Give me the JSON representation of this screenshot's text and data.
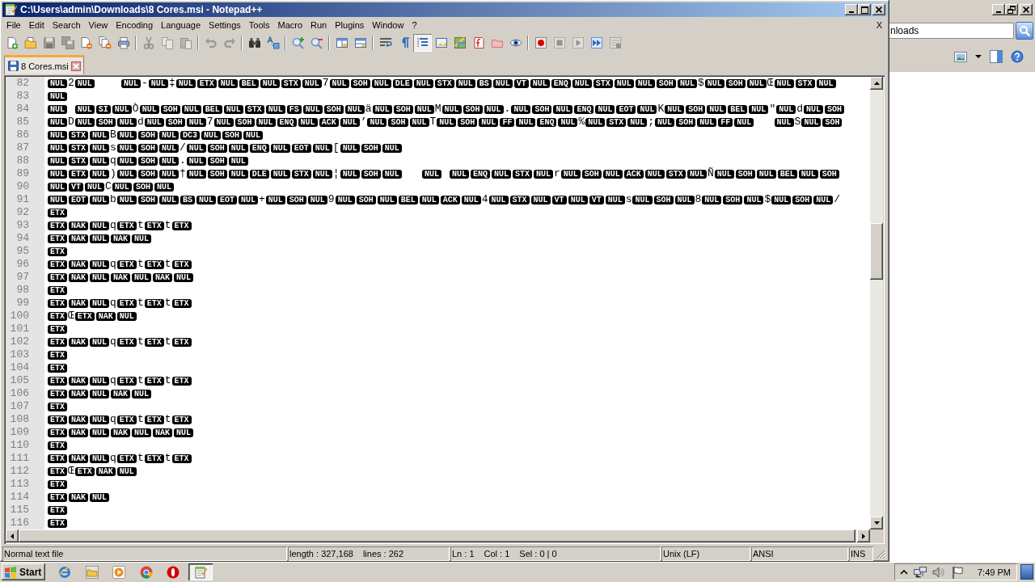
{
  "window": {
    "title": "C:\\Users\\admin\\Downloads\\8 Cores.msi - Notepad++"
  },
  "menu": {
    "items": [
      "File",
      "Edit",
      "Search",
      "View",
      "Encoding",
      "Language",
      "Settings",
      "Tools",
      "Macro",
      "Run",
      "Plugins",
      "Window",
      "?"
    ],
    "close": "X"
  },
  "toolbar": [
    {
      "pressed": false,
      "disabled": false
    },
    {
      "pressed": false,
      "disabled": false
    },
    {
      "pressed": false,
      "disabled": true
    },
    {
      "pressed": false,
      "disabled": true
    },
    {
      "pressed": false,
      "disabled": false
    },
    {
      "pressed": false,
      "disabled": false
    },
    {
      "pressed": false,
      "disabled": false
    },
    {
      "pressed": false,
      "disabled": true
    },
    {
      "pressed": false,
      "disabled": true
    },
    {
      "pressed": false,
      "disabled": true
    },
    {
      "pressed": false,
      "disabled": true
    },
    {
      "pressed": false,
      "disabled": true
    },
    {
      "pressed": false,
      "disabled": false
    },
    {
      "pressed": false,
      "disabled": false
    },
    {
      "pressed": false,
      "disabled": false
    },
    {
      "pressed": false,
      "disabled": false
    },
    {
      "pressed": false,
      "disabled": false
    },
    {
      "pressed": false,
      "disabled": false
    },
    {
      "pressed": false,
      "disabled": false
    },
    {
      "pressed": false,
      "disabled": false
    },
    {
      "pressed": true,
      "disabled": false
    },
    {
      "pressed": false,
      "disabled": false
    },
    {
      "pressed": false,
      "disabled": false
    },
    {
      "pressed": false,
      "disabled": false
    },
    {
      "pressed": false,
      "disabled": false
    },
    {
      "pressed": false,
      "disabled": false
    },
    {
      "pressed": false,
      "disabled": false
    },
    {
      "pressed": false,
      "disabled": true
    },
    {
      "pressed": false,
      "disabled": true
    },
    {
      "pressed": false,
      "disabled": false
    },
    {
      "pressed": false,
      "disabled": true
    }
  ],
  "tabs": [
    {
      "label": "8 Cores.msi",
      "selected": true
    }
  ],
  "editor": {
    "lines": [
      {
        "number": "82",
        "tokens": [
          {
            "kind": "ctrl",
            "text": "NUL"
          },
          {
            "kind": "char",
            "text": "2"
          },
          {
            "kind": "ctrl",
            "text": "NUL"
          },
          {
            "kind": "space"
          },
          {
            "kind": "space"
          },
          {
            "kind": "space"
          },
          {
            "kind": "space"
          },
          {
            "kind": "ctrl",
            "text": "NUL"
          },
          {
            "kind": "char",
            "text": "-"
          },
          {
            "kind": "ctrl",
            "text": "NUL"
          },
          {
            "kind": "char",
            "text": "‡"
          },
          {
            "kind": "ctrl",
            "text": "NUL"
          },
          {
            "kind": "ctrl",
            "text": "ETX"
          },
          {
            "kind": "ctrl",
            "text": "NUL"
          },
          {
            "kind": "ctrl",
            "text": "BEL"
          },
          {
            "kind": "ctrl",
            "text": "NUL"
          },
          {
            "kind": "ctrl",
            "text": "STX"
          },
          {
            "kind": "ctrl",
            "text": "NUL"
          },
          {
            "kind": "char",
            "text": "7"
          },
          {
            "kind": "ctrl",
            "text": "NUL"
          },
          {
            "kind": "ctrl",
            "text": "SOH"
          },
          {
            "kind": "ctrl",
            "text": "NUL"
          },
          {
            "kind": "ctrl",
            "text": "DLE"
          },
          {
            "kind": "ctrl",
            "text": "NUL"
          },
          {
            "kind": "ctrl",
            "text": "STX"
          },
          {
            "kind": "ctrl",
            "text": "NUL"
          },
          {
            "kind": "ctrl",
            "text": "BS"
          },
          {
            "kind": "ctrl",
            "text": "NUL"
          },
          {
            "kind": "ctrl",
            "text": "VT"
          },
          {
            "kind": "ctrl",
            "text": "NUL"
          },
          {
            "kind": "ctrl",
            "text": "ENQ"
          },
          {
            "kind": "ctrl",
            "text": "NUL"
          },
          {
            "kind": "ctrl",
            "text": "STX"
          },
          {
            "kind": "ctrl",
            "text": "NUL"
          },
          {
            "kind": "ctrl",
            "text": "NUL"
          },
          {
            "kind": "ctrl",
            "text": "SOH"
          },
          {
            "kind": "ctrl",
            "text": "NUL"
          },
          {
            "kind": "char",
            "text": "$"
          },
          {
            "kind": "ctrl",
            "text": "NUL"
          },
          {
            "kind": "ctrl",
            "text": "SOH"
          },
          {
            "kind": "ctrl",
            "text": "NUL"
          },
          {
            "kind": "char",
            "text": "Œ"
          },
          {
            "kind": "ctrl",
            "text": "NUL"
          },
          {
            "kind": "ctrl",
            "text": "STX"
          },
          {
            "kind": "ctrl",
            "text": "NUL"
          }
        ]
      },
      {
        "number": "83",
        "tokens": [
          {
            "kind": "ctrl",
            "text": "NUL"
          }
        ]
      },
      {
        "number": "84",
        "tokens": [
          {
            "kind": "ctrl",
            "text": "NUL"
          },
          {
            "kind": "space"
          },
          {
            "kind": "ctrl",
            "text": "NUL"
          },
          {
            "kind": "ctrl",
            "text": "SI"
          },
          {
            "kind": "ctrl",
            "text": "NUL"
          },
          {
            "kind": "char",
            "text": "Ò"
          },
          {
            "kind": "ctrl",
            "text": "NUL"
          },
          {
            "kind": "ctrl",
            "text": "SOH"
          },
          {
            "kind": "ctrl",
            "text": "NUL"
          },
          {
            "kind": "ctrl",
            "text": "BEL"
          },
          {
            "kind": "ctrl",
            "text": "NUL"
          },
          {
            "kind": "ctrl",
            "text": "STX"
          },
          {
            "kind": "ctrl",
            "text": "NUL"
          },
          {
            "kind": "ctrl",
            "text": "FS"
          },
          {
            "kind": "ctrl",
            "text": "NUL"
          },
          {
            "kind": "ctrl",
            "text": "SOH"
          },
          {
            "kind": "ctrl",
            "text": "NUL"
          },
          {
            "kind": "char",
            "text": "ä"
          },
          {
            "kind": "ctrl",
            "text": "NUL"
          },
          {
            "kind": "ctrl",
            "text": "SOH"
          },
          {
            "kind": "ctrl",
            "text": "NUL"
          },
          {
            "kind": "char",
            "text": "M"
          },
          {
            "kind": "ctrl",
            "text": "NUL"
          },
          {
            "kind": "ctrl",
            "text": "SOH"
          },
          {
            "kind": "ctrl",
            "text": "NUL"
          },
          {
            "kind": "char",
            "text": "."
          },
          {
            "kind": "ctrl",
            "text": "NUL"
          },
          {
            "kind": "ctrl",
            "text": "SOH"
          },
          {
            "kind": "ctrl",
            "text": "NUL"
          },
          {
            "kind": "ctrl",
            "text": "ENQ"
          },
          {
            "kind": "ctrl",
            "text": "NUL"
          },
          {
            "kind": "ctrl",
            "text": "EOT"
          },
          {
            "kind": "ctrl",
            "text": "NUL"
          },
          {
            "kind": "char",
            "text": "K"
          },
          {
            "kind": "ctrl",
            "text": "NUL"
          },
          {
            "kind": "ctrl",
            "text": "SOH"
          },
          {
            "kind": "ctrl",
            "text": "NUL"
          },
          {
            "kind": "ctrl",
            "text": "BEL"
          },
          {
            "kind": "ctrl",
            "text": "NUL"
          },
          {
            "kind": "char",
            "text": "\""
          },
          {
            "kind": "ctrl",
            "text": "NUL"
          },
          {
            "kind": "char",
            "text": "d"
          },
          {
            "kind": "ctrl",
            "text": "NUL"
          },
          {
            "kind": "ctrl",
            "text": "SOH"
          }
        ]
      },
      {
        "number": "85",
        "tokens": [
          {
            "kind": "ctrl",
            "text": "NUL"
          },
          {
            "kind": "char",
            "text": "D"
          },
          {
            "kind": "ctrl",
            "text": "NUL"
          },
          {
            "kind": "ctrl",
            "text": "SOH"
          },
          {
            "kind": "ctrl",
            "text": "NUL"
          },
          {
            "kind": "char",
            "text": "d"
          },
          {
            "kind": "ctrl",
            "text": "NUL"
          },
          {
            "kind": "ctrl",
            "text": "SOH"
          },
          {
            "kind": "ctrl",
            "text": "NUL"
          },
          {
            "kind": "char",
            "text": "7"
          },
          {
            "kind": "ctrl",
            "text": "NUL"
          },
          {
            "kind": "ctrl",
            "text": "SOH"
          },
          {
            "kind": "ctrl",
            "text": "NUL"
          },
          {
            "kind": "ctrl",
            "text": "ENQ"
          },
          {
            "kind": "ctrl",
            "text": "NUL"
          },
          {
            "kind": "ctrl",
            "text": "ACK"
          },
          {
            "kind": "ctrl",
            "text": "NUL"
          },
          {
            "kind": "char",
            "text": "’"
          },
          {
            "kind": "ctrl",
            "text": "NUL"
          },
          {
            "kind": "ctrl",
            "text": "SOH"
          },
          {
            "kind": "ctrl",
            "text": "NUL"
          },
          {
            "kind": "char",
            "text": "T"
          },
          {
            "kind": "ctrl",
            "text": "NUL"
          },
          {
            "kind": "ctrl",
            "text": "SOH"
          },
          {
            "kind": "ctrl",
            "text": "NUL"
          },
          {
            "kind": "ctrl",
            "text": "FF"
          },
          {
            "kind": "ctrl",
            "text": "NUL"
          },
          {
            "kind": "ctrl",
            "text": "ENQ"
          },
          {
            "kind": "ctrl",
            "text": "NUL"
          },
          {
            "kind": "char",
            "text": "%"
          },
          {
            "kind": "ctrl",
            "text": "NUL"
          },
          {
            "kind": "ctrl",
            "text": "STX"
          },
          {
            "kind": "ctrl",
            "text": "NUL"
          },
          {
            "kind": "char",
            "text": ";"
          },
          {
            "kind": "ctrl",
            "text": "NUL"
          },
          {
            "kind": "ctrl",
            "text": "SOH"
          },
          {
            "kind": "ctrl",
            "text": "NUL"
          },
          {
            "kind": "ctrl",
            "text": "FF"
          },
          {
            "kind": "ctrl",
            "text": "NUL"
          },
          {
            "kind": "space"
          },
          {
            "kind": "space"
          },
          {
            "kind": "space"
          },
          {
            "kind": "ctrl",
            "text": "NUL"
          },
          {
            "kind": "char",
            "text": "S"
          },
          {
            "kind": "ctrl",
            "text": "NUL"
          },
          {
            "kind": "ctrl",
            "text": "SOH"
          }
        ]
      },
      {
        "number": "86",
        "tokens": [
          {
            "kind": "ctrl",
            "text": "NUL"
          },
          {
            "kind": "ctrl",
            "text": "STX"
          },
          {
            "kind": "ctrl",
            "text": "NUL"
          },
          {
            "kind": "char",
            "text": "B"
          },
          {
            "kind": "ctrl",
            "text": "NUL"
          },
          {
            "kind": "ctrl",
            "text": "SOH"
          },
          {
            "kind": "ctrl",
            "text": "NUL"
          },
          {
            "kind": "ctrl",
            "text": "DC3"
          },
          {
            "kind": "ctrl",
            "text": "NUL"
          },
          {
            "kind": "ctrl",
            "text": "SOH"
          },
          {
            "kind": "ctrl",
            "text": "NUL"
          }
        ]
      },
      {
        "number": "87",
        "tokens": [
          {
            "kind": "ctrl",
            "text": "NUL"
          },
          {
            "kind": "ctrl",
            "text": "STX"
          },
          {
            "kind": "ctrl",
            "text": "NUL"
          },
          {
            "kind": "char",
            "text": "s"
          },
          {
            "kind": "ctrl",
            "text": "NUL"
          },
          {
            "kind": "ctrl",
            "text": "SOH"
          },
          {
            "kind": "ctrl",
            "text": "NUL"
          },
          {
            "kind": "char",
            "text": "/"
          },
          {
            "kind": "ctrl",
            "text": "NUL"
          },
          {
            "kind": "ctrl",
            "text": "SOH"
          },
          {
            "kind": "ctrl",
            "text": "NUL"
          },
          {
            "kind": "ctrl",
            "text": "ENQ"
          },
          {
            "kind": "ctrl",
            "text": "NUL"
          },
          {
            "kind": "ctrl",
            "text": "EOT"
          },
          {
            "kind": "ctrl",
            "text": "NUL"
          },
          {
            "kind": "char",
            "text": "["
          },
          {
            "kind": "ctrl",
            "text": "NUL"
          },
          {
            "kind": "ctrl",
            "text": "SOH"
          },
          {
            "kind": "ctrl",
            "text": "NUL"
          }
        ]
      },
      {
        "number": "88",
        "tokens": [
          {
            "kind": "ctrl",
            "text": "NUL"
          },
          {
            "kind": "ctrl",
            "text": "STX"
          },
          {
            "kind": "ctrl",
            "text": "NUL"
          },
          {
            "kind": "char",
            "text": "q"
          },
          {
            "kind": "ctrl",
            "text": "NUL"
          },
          {
            "kind": "ctrl",
            "text": "SOH"
          },
          {
            "kind": "ctrl",
            "text": "NUL"
          },
          {
            "kind": "char",
            "text": "."
          },
          {
            "kind": "ctrl",
            "text": "NUL"
          },
          {
            "kind": "ctrl",
            "text": "SOH"
          },
          {
            "kind": "ctrl",
            "text": "NUL"
          }
        ]
      },
      {
        "number": "89",
        "tokens": [
          {
            "kind": "ctrl",
            "text": "NUL"
          },
          {
            "kind": "ctrl",
            "text": "ETX"
          },
          {
            "kind": "ctrl",
            "text": "NUL"
          },
          {
            "kind": "char",
            "text": ")"
          },
          {
            "kind": "ctrl",
            "text": "NUL"
          },
          {
            "kind": "ctrl",
            "text": "SOH"
          },
          {
            "kind": "ctrl",
            "text": "NUL"
          },
          {
            "kind": "char",
            "text": "†"
          },
          {
            "kind": "ctrl",
            "text": "NUL"
          },
          {
            "kind": "ctrl",
            "text": "SOH"
          },
          {
            "kind": "ctrl",
            "text": "NUL"
          },
          {
            "kind": "ctrl",
            "text": "DLE"
          },
          {
            "kind": "ctrl",
            "text": "NUL"
          },
          {
            "kind": "ctrl",
            "text": "STX"
          },
          {
            "kind": "ctrl",
            "text": "NUL"
          },
          {
            "kind": "char",
            "text": "¦"
          },
          {
            "kind": "ctrl",
            "text": "NUL"
          },
          {
            "kind": "ctrl",
            "text": "SOH"
          },
          {
            "kind": "ctrl",
            "text": "NUL"
          },
          {
            "kind": "space"
          },
          {
            "kind": "space"
          },
          {
            "kind": "space"
          },
          {
            "kind": "ctrl",
            "text": "NUL"
          },
          {
            "kind": "space"
          },
          {
            "kind": "ctrl",
            "text": "NUL"
          },
          {
            "kind": "ctrl",
            "text": "ENQ"
          },
          {
            "kind": "ctrl",
            "text": "NUL"
          },
          {
            "kind": "ctrl",
            "text": "STX"
          },
          {
            "kind": "ctrl",
            "text": "NUL"
          },
          {
            "kind": "char",
            "text": "r"
          },
          {
            "kind": "ctrl",
            "text": "NUL"
          },
          {
            "kind": "ctrl",
            "text": "SOH"
          },
          {
            "kind": "ctrl",
            "text": "NUL"
          },
          {
            "kind": "ctrl",
            "text": "ACK"
          },
          {
            "kind": "ctrl",
            "text": "NUL"
          },
          {
            "kind": "ctrl",
            "text": "STX"
          },
          {
            "kind": "ctrl",
            "text": "NUL"
          },
          {
            "kind": "char",
            "text": "Ñ"
          },
          {
            "kind": "ctrl",
            "text": "NUL"
          },
          {
            "kind": "ctrl",
            "text": "SOH"
          },
          {
            "kind": "ctrl",
            "text": "NUL"
          },
          {
            "kind": "ctrl",
            "text": "BEL"
          },
          {
            "kind": "ctrl",
            "text": "NUL"
          },
          {
            "kind": "ctrl",
            "text": "SOH"
          }
        ]
      },
      {
        "number": "90",
        "tokens": [
          {
            "kind": "ctrl",
            "text": "NUL"
          },
          {
            "kind": "ctrl",
            "text": "VT"
          },
          {
            "kind": "ctrl",
            "text": "NUL"
          },
          {
            "kind": "char",
            "text": "C"
          },
          {
            "kind": "ctrl",
            "text": "NUL"
          },
          {
            "kind": "ctrl",
            "text": "SOH"
          },
          {
            "kind": "ctrl",
            "text": "NUL"
          }
        ]
      },
      {
        "number": "91",
        "tokens": [
          {
            "kind": "ctrl",
            "text": "NUL"
          },
          {
            "kind": "ctrl",
            "text": "EOT"
          },
          {
            "kind": "ctrl",
            "text": "NUL"
          },
          {
            "kind": "char",
            "text": "b"
          },
          {
            "kind": "ctrl",
            "text": "NUL"
          },
          {
            "kind": "ctrl",
            "text": "SOH"
          },
          {
            "kind": "ctrl",
            "text": "NUL"
          },
          {
            "kind": "ctrl",
            "text": "BS"
          },
          {
            "kind": "ctrl",
            "text": "NUL"
          },
          {
            "kind": "ctrl",
            "text": "EOT"
          },
          {
            "kind": "ctrl",
            "text": "NUL"
          },
          {
            "kind": "char",
            "text": "+"
          },
          {
            "kind": "ctrl",
            "text": "NUL"
          },
          {
            "kind": "ctrl",
            "text": "SOH"
          },
          {
            "kind": "ctrl",
            "text": "NUL"
          },
          {
            "kind": "char",
            "text": "9"
          },
          {
            "kind": "ctrl",
            "text": "NUL"
          },
          {
            "kind": "ctrl",
            "text": "SOH"
          },
          {
            "kind": "ctrl",
            "text": "NUL"
          },
          {
            "kind": "ctrl",
            "text": "BEL"
          },
          {
            "kind": "ctrl",
            "text": "NUL"
          },
          {
            "kind": "ctrl",
            "text": "ACK"
          },
          {
            "kind": "ctrl",
            "text": "NUL"
          },
          {
            "kind": "char",
            "text": "4"
          },
          {
            "kind": "ctrl",
            "text": "NUL"
          },
          {
            "kind": "ctrl",
            "text": "STX"
          },
          {
            "kind": "ctrl",
            "text": "NUL"
          },
          {
            "kind": "ctrl",
            "text": "VT"
          },
          {
            "kind": "ctrl",
            "text": "NUL"
          },
          {
            "kind": "ctrl",
            "text": "VT"
          },
          {
            "kind": "ctrl",
            "text": "NUL"
          },
          {
            "kind": "char",
            "text": "s"
          },
          {
            "kind": "ctrl",
            "text": "NUL"
          },
          {
            "kind": "ctrl",
            "text": "SOH"
          },
          {
            "kind": "ctrl",
            "text": "NUL"
          },
          {
            "kind": "char",
            "text": "8"
          },
          {
            "kind": "ctrl",
            "text": "NUL"
          },
          {
            "kind": "ctrl",
            "text": "SOH"
          },
          {
            "kind": "ctrl",
            "text": "NUL"
          },
          {
            "kind": "char",
            "text": "$"
          },
          {
            "kind": "ctrl",
            "text": "NUL"
          },
          {
            "kind": "ctrl",
            "text": "SOH"
          },
          {
            "kind": "ctrl",
            "text": "NUL"
          },
          {
            "kind": "char",
            "text": "/"
          }
        ]
      },
      {
        "number": "92",
        "tokens": [
          {
            "kind": "ctrl",
            "text": "ETX"
          }
        ]
      },
      {
        "number": "93",
        "tokens": [
          {
            "kind": "ctrl",
            "text": "ETX"
          },
          {
            "kind": "ctrl",
            "text": "NAK"
          },
          {
            "kind": "ctrl",
            "text": "NUL"
          },
          {
            "kind": "char",
            "text": "q"
          },
          {
            "kind": "ctrl",
            "text": "ETX"
          },
          {
            "kind": "char",
            "text": "t"
          },
          {
            "kind": "ctrl",
            "text": "ETX"
          },
          {
            "kind": "char",
            "text": "t"
          },
          {
            "kind": "ctrl",
            "text": "ETX"
          }
        ]
      },
      {
        "number": "94",
        "tokens": [
          {
            "kind": "ctrl",
            "text": "ETX"
          },
          {
            "kind": "ctrl",
            "text": "NAK"
          },
          {
            "kind": "ctrl",
            "text": "NUL"
          },
          {
            "kind": "ctrl",
            "text": "NAK"
          },
          {
            "kind": "ctrl",
            "text": "NUL"
          }
        ]
      },
      {
        "number": "95",
        "tokens": [
          {
            "kind": "ctrl",
            "text": "ETX"
          }
        ]
      },
      {
        "number": "96",
        "tokens": [
          {
            "kind": "ctrl",
            "text": "ETX"
          },
          {
            "kind": "ctrl",
            "text": "NAK"
          },
          {
            "kind": "ctrl",
            "text": "NUL"
          },
          {
            "kind": "char",
            "text": "q"
          },
          {
            "kind": "ctrl",
            "text": "ETX"
          },
          {
            "kind": "char",
            "text": "t"
          },
          {
            "kind": "ctrl",
            "text": "ETX"
          },
          {
            "kind": "char",
            "text": "t"
          },
          {
            "kind": "ctrl",
            "text": "ETX"
          }
        ]
      },
      {
        "number": "97",
        "tokens": [
          {
            "kind": "ctrl",
            "text": "ETX"
          },
          {
            "kind": "ctrl",
            "text": "NAK"
          },
          {
            "kind": "ctrl",
            "text": "NUL"
          },
          {
            "kind": "ctrl",
            "text": "NAK"
          },
          {
            "kind": "ctrl",
            "text": "NUL"
          },
          {
            "kind": "ctrl",
            "text": "NAK"
          },
          {
            "kind": "ctrl",
            "text": "NUL"
          }
        ]
      },
      {
        "number": "98",
        "tokens": [
          {
            "kind": "ctrl",
            "text": "ETX"
          }
        ]
      },
      {
        "number": "99",
        "tokens": [
          {
            "kind": "ctrl",
            "text": "ETX"
          },
          {
            "kind": "ctrl",
            "text": "NAK"
          },
          {
            "kind": "ctrl",
            "text": "NUL"
          },
          {
            "kind": "char",
            "text": "q"
          },
          {
            "kind": "ctrl",
            "text": "ETX"
          },
          {
            "kind": "char",
            "text": "t"
          },
          {
            "kind": "ctrl",
            "text": "ETX"
          },
          {
            "kind": "char",
            "text": "t"
          },
          {
            "kind": "ctrl",
            "text": "ETX"
          }
        ]
      },
      {
        "number": "100",
        "tokens": [
          {
            "kind": "ctrl",
            "text": "ETX"
          },
          {
            "kind": "char",
            "text": "Œ"
          },
          {
            "kind": "ctrl",
            "text": "ETX"
          },
          {
            "kind": "ctrl",
            "text": "NAK"
          },
          {
            "kind": "ctrl",
            "text": "NUL"
          }
        ]
      },
      {
        "number": "101",
        "tokens": [
          {
            "kind": "ctrl",
            "text": "ETX"
          }
        ]
      },
      {
        "number": "102",
        "tokens": [
          {
            "kind": "ctrl",
            "text": "ETX"
          },
          {
            "kind": "ctrl",
            "text": "NAK"
          },
          {
            "kind": "ctrl",
            "text": "NUL"
          },
          {
            "kind": "char",
            "text": "q"
          },
          {
            "kind": "ctrl",
            "text": "ETX"
          },
          {
            "kind": "char",
            "text": "t"
          },
          {
            "kind": "ctrl",
            "text": "ETX"
          },
          {
            "kind": "char",
            "text": "t"
          },
          {
            "kind": "ctrl",
            "text": "ETX"
          }
        ]
      },
      {
        "number": "103",
        "tokens": [
          {
            "kind": "ctrl",
            "text": "ETX"
          }
        ]
      },
      {
        "number": "104",
        "tokens": [
          {
            "kind": "ctrl",
            "text": "ETX"
          }
        ]
      },
      {
        "number": "105",
        "tokens": [
          {
            "kind": "ctrl",
            "text": "ETX"
          },
          {
            "kind": "ctrl",
            "text": "NAK"
          },
          {
            "kind": "ctrl",
            "text": "NUL"
          },
          {
            "kind": "char",
            "text": "q"
          },
          {
            "kind": "ctrl",
            "text": "ETX"
          },
          {
            "kind": "char",
            "text": "t"
          },
          {
            "kind": "ctrl",
            "text": "ETX"
          },
          {
            "kind": "char",
            "text": "t"
          },
          {
            "kind": "ctrl",
            "text": "ETX"
          }
        ]
      },
      {
        "number": "106",
        "tokens": [
          {
            "kind": "ctrl",
            "text": "ETX"
          },
          {
            "kind": "ctrl",
            "text": "NAK"
          },
          {
            "kind": "ctrl",
            "text": "NUL"
          },
          {
            "kind": "ctrl",
            "text": "NAK"
          },
          {
            "kind": "ctrl",
            "text": "NUL"
          }
        ]
      },
      {
        "number": "107",
        "tokens": [
          {
            "kind": "ctrl",
            "text": "ETX"
          }
        ]
      },
      {
        "number": "108",
        "tokens": [
          {
            "kind": "ctrl",
            "text": "ETX"
          },
          {
            "kind": "ctrl",
            "text": "NAK"
          },
          {
            "kind": "ctrl",
            "text": "NUL"
          },
          {
            "kind": "char",
            "text": "q"
          },
          {
            "kind": "ctrl",
            "text": "ETX"
          },
          {
            "kind": "char",
            "text": "t"
          },
          {
            "kind": "ctrl",
            "text": "ETX"
          },
          {
            "kind": "char",
            "text": "t"
          },
          {
            "kind": "ctrl",
            "text": "ETX"
          }
        ]
      },
      {
        "number": "109",
        "tokens": [
          {
            "kind": "ctrl",
            "text": "ETX"
          },
          {
            "kind": "ctrl",
            "text": "NAK"
          },
          {
            "kind": "ctrl",
            "text": "NUL"
          },
          {
            "kind": "ctrl",
            "text": "NAK"
          },
          {
            "kind": "ctrl",
            "text": "NUL"
          },
          {
            "kind": "ctrl",
            "text": "NAK"
          },
          {
            "kind": "ctrl",
            "text": "NUL"
          }
        ]
      },
      {
        "number": "110",
        "tokens": [
          {
            "kind": "ctrl",
            "text": "ETX"
          }
        ]
      },
      {
        "number": "111",
        "tokens": [
          {
            "kind": "ctrl",
            "text": "ETX"
          },
          {
            "kind": "ctrl",
            "text": "NAK"
          },
          {
            "kind": "ctrl",
            "text": "NUL"
          },
          {
            "kind": "char",
            "text": "q"
          },
          {
            "kind": "ctrl",
            "text": "ETX"
          },
          {
            "kind": "char",
            "text": "t"
          },
          {
            "kind": "ctrl",
            "text": "ETX"
          },
          {
            "kind": "char",
            "text": "t"
          },
          {
            "kind": "ctrl",
            "text": "ETX"
          }
        ]
      },
      {
        "number": "112",
        "tokens": [
          {
            "kind": "ctrl",
            "text": "ETX"
          },
          {
            "kind": "char",
            "text": "Œ"
          },
          {
            "kind": "ctrl",
            "text": "ETX"
          },
          {
            "kind": "ctrl",
            "text": "NAK"
          },
          {
            "kind": "ctrl",
            "text": "NUL"
          }
        ]
      },
      {
        "number": "113",
        "tokens": [
          {
            "kind": "ctrl",
            "text": "ETX"
          }
        ]
      },
      {
        "number": "114",
        "tokens": [
          {
            "kind": "ctrl",
            "text": "ETX"
          },
          {
            "kind": "ctrl",
            "text": "NAK"
          },
          {
            "kind": "ctrl",
            "text": "NUL"
          }
        ]
      },
      {
        "number": "115",
        "tokens": [
          {
            "kind": "ctrl",
            "text": "ETX"
          }
        ]
      },
      {
        "number": "116",
        "tokens": [
          {
            "kind": "ctrl",
            "text": "ETX"
          }
        ]
      }
    ]
  },
  "status_bar": [
    {
      "texts": [
        "Normal text file"
      ]
    },
    {
      "texts": [
        "length : 327,168",
        "lines : 262"
      ]
    },
    {
      "texts": [
        "Ln : 1",
        "Col : 1",
        "Sel : 0 | 0"
      ]
    },
    {
      "texts": [
        "Unix (LF)"
      ]
    },
    {
      "texts": [
        "ANSI"
      ]
    },
    {
      "texts": [
        "INS"
      ]
    }
  ],
  "background_window": {
    "address": "nloads"
  },
  "taskbar": {
    "start": "Start",
    "buttons": [
      {
        "active": false
      },
      {
        "active": false
      },
      {
        "active": false
      },
      {
        "active": false
      },
      {
        "active": false
      },
      {
        "active": true
      }
    ],
    "clock": "7:49 PM"
  }
}
